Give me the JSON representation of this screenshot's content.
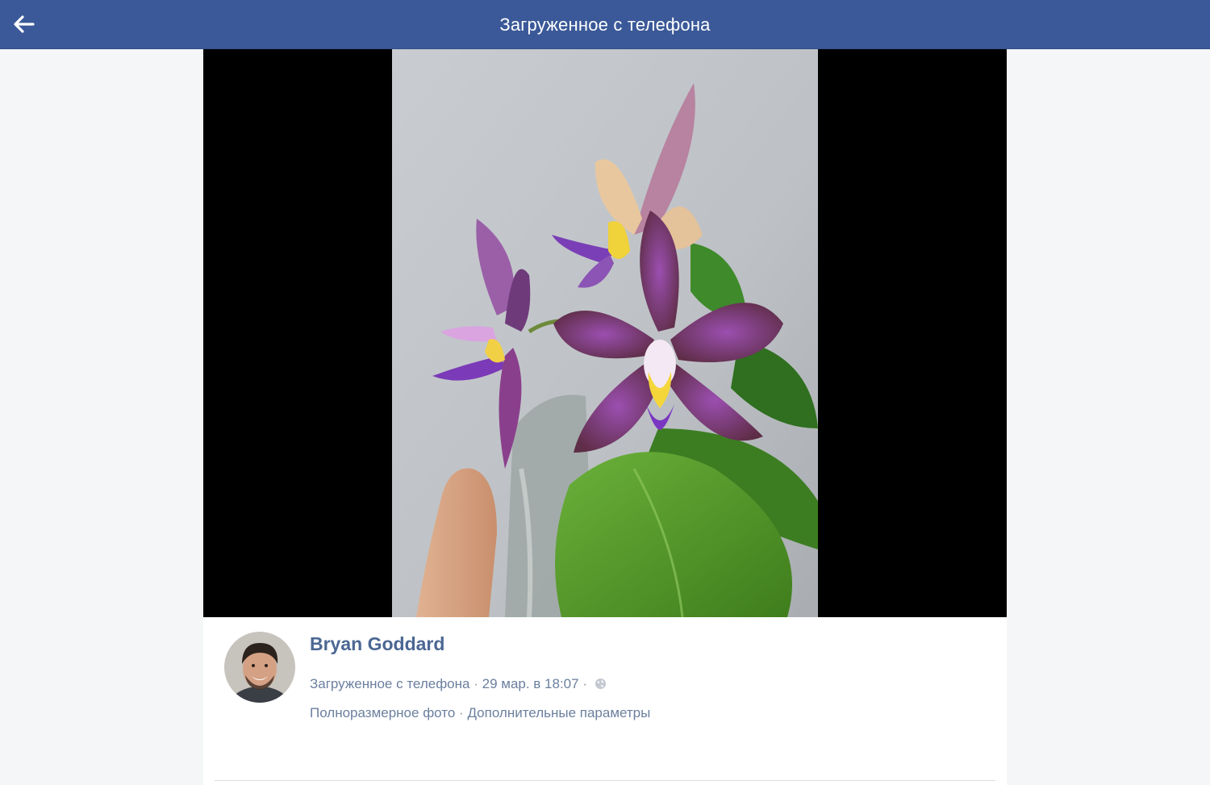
{
  "header": {
    "title": "Загруженное с телефона",
    "back_icon": "arrow-left-icon",
    "background_color": "#3b5998"
  },
  "photo": {
    "description_icon": "orchid-photo"
  },
  "post": {
    "author_name": "Bryan Goddard",
    "album_link": "Загруженное с телефона",
    "separator": "·",
    "date": "29 мар. в 18:07",
    "privacy_icon": "globe-icon",
    "full_size_link": "Полноразмерное фото",
    "more_options_link": "Дополнительные параметры"
  },
  "colors": {
    "accent": "#3b5998",
    "link": "#4b6793",
    "meta_text": "#7f8fa4"
  }
}
